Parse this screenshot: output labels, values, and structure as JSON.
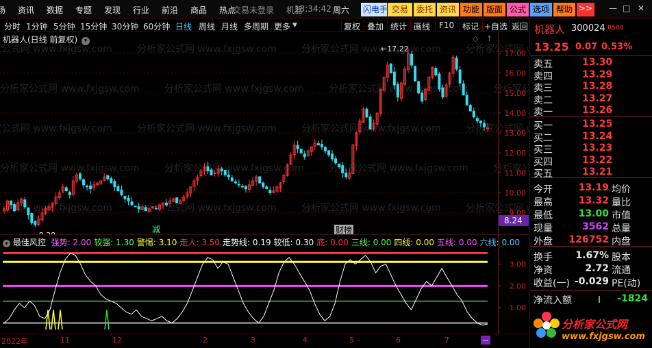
{
  "menubar": {
    "items": [
      "场",
      "资讯",
      "数据",
      "专题",
      "发现",
      "行业",
      "前沿",
      "商品",
      "热点"
    ],
    "login_status": "交易未登录",
    "robot_label": "机器",
    "clock": "13:34:42",
    "weekday": "周六",
    "tools": [
      {
        "label": "闪电手",
        "bg": "#cfe4ff",
        "fg": "#0033aa"
      },
      {
        "label": "交易",
        "bg": "#ffd94a",
        "fg": "#7a3000"
      },
      {
        "label": "委托",
        "bg": "#ffd94a",
        "fg": "#7a3000"
      },
      {
        "label": "资讯",
        "bg": "#ffd94a",
        "fg": "#7a3000"
      },
      {
        "label": "功能",
        "bg": "#ff7a1a",
        "fg": "#000000"
      },
      {
        "label": "版面",
        "bg": "#ff7a1a",
        "fg": "#000000"
      },
      {
        "label": "公式",
        "bg": "#ff5aaa",
        "fg": "#000000"
      },
      {
        "label": "选项",
        "bg": "#5aa0ff",
        "fg": "#000000"
      },
      {
        "label": "帮助",
        "bg": "#ff7a1a",
        "fg": "#000000"
      },
      {
        "label": ">>",
        "bg": "#ff3030",
        "fg": "#ffffff"
      }
    ]
  },
  "periods": {
    "items": [
      "分时",
      "1分钟",
      "5分钟",
      "15分钟",
      "30分钟",
      "60分钟",
      "日线",
      "周线",
      "月线",
      "多周期",
      "更多"
    ],
    "active": "日线",
    "right_tools": [
      "复权",
      "叠加",
      "统计",
      "画线",
      "F10",
      "标记",
      "+自选",
      "返回"
    ]
  },
  "chart": {
    "title": "机器人(日线 前复权)",
    "y_ticks": [
      "17.00",
      "16.00",
      "15.00",
      "14.00",
      "13.00",
      "12.00",
      "11.00",
      "10.00",
      "9.00"
    ],
    "high_label": "17.22",
    "low_label": "8.38",
    "current_price_tag": "8.24",
    "event_labels": [
      "减",
      "财榜"
    ],
    "watermark": "分析家公式网 www.fxjgsw.com",
    "colors": {
      "up": "#ff3333",
      "down": "#33ddee",
      "grid": "#5a0000",
      "bg": "#000000"
    },
    "chart_data": {
      "type": "candlestick",
      "title": "机器人(日线 前复权)",
      "ylim": [
        8.2,
        17.6
      ],
      "max_label": 17.22,
      "min_label": 8.38,
      "closes": [
        9.2,
        9.6,
        9.4,
        9.1,
        9.5,
        9.7,
        9.3,
        8.9,
        8.5,
        8.4,
        8.7,
        9.0,
        9.2,
        9.3,
        9.5,
        9.8,
        10.0,
        10.3,
        10.1,
        9.9,
        10.6,
        10.9,
        10.7,
        10.4,
        10.3,
        10.2,
        10.4,
        10.5,
        10.6,
        10.8,
        10.7,
        10.5,
        10.3,
        10.1,
        9.9,
        9.7,
        9.6,
        9.4,
        9.3,
        9.2,
        9.3,
        9.1,
        9.2,
        9.3,
        9.2,
        9.4,
        9.5,
        9.4,
        9.6,
        9.7,
        9.5,
        9.6,
        9.8,
        10.0,
        10.3,
        10.6,
        10.8,
        11.1,
        11.3,
        11.1,
        10.9,
        11.0,
        11.2,
        11.1,
        10.9,
        10.8,
        10.6,
        10.5,
        10.4,
        10.3,
        10.2,
        10.4,
        10.6,
        10.8,
        10.5,
        10.3,
        10.2,
        10.0,
        10.1,
        10.3,
        10.5,
        10.9,
        11.4,
        11.9,
        12.4,
        12.2,
        12.0,
        11.8,
        12.1,
        12.3,
        12.5,
        12.4,
        12.3,
        12.1,
        11.9,
        11.7,
        11.5,
        11.3,
        11.0,
        10.8,
        11.0,
        12.4,
        13.0,
        13.6,
        14.2,
        13.8,
        13.2,
        13.5,
        14.0,
        15.2,
        15.8,
        16.4,
        16.0,
        15.4,
        14.8,
        15.5,
        16.2,
        17.0,
        16.4,
        15.6,
        15.0,
        14.6,
        15.2,
        15.8,
        16.3,
        15.9,
        15.2,
        14.8,
        15.4,
        16.0,
        16.8,
        16.2,
        15.5,
        14.9,
        14.4,
        14.1,
        13.8,
        13.6,
        13.5,
        13.3,
        13.25
      ]
    }
  },
  "indicator": {
    "name": "最佳风控",
    "legend": [
      {
        "label": "强势:",
        "value": "2.00",
        "color": "#ff55ff"
      },
      {
        "label": "较强:",
        "value": "1.30",
        "color": "#55ff55"
      },
      {
        "label": "警惕:",
        "value": "3.10",
        "color": "#ffff33"
      },
      {
        "label": "走人:",
        "value": "3.50",
        "color": "#ff3333"
      },
      {
        "label": "走势线:",
        "value": "0.19",
        "color": "#ffffff"
      },
      {
        "label": "较低:",
        "value": "0.30",
        "color": "#ffffff"
      },
      {
        "label": "底:",
        "value": "0.00",
        "color": "#ff3333"
      },
      {
        "label": "三线:",
        "value": "0.00",
        "color": "#55ff55"
      },
      {
        "label": "四线:",
        "value": "0.00",
        "color": "#ffff33"
      },
      {
        "label": "五线:",
        "value": "0.00",
        "color": "#ff55ff"
      },
      {
        "label": "六线:",
        "value": "0.00",
        "color": "#55ccff"
      }
    ],
    "y_ticks": [
      "3.00",
      "2.00",
      "1.00"
    ],
    "levels": [
      {
        "value": 3.5,
        "color": "#ff3333"
      },
      {
        "value": 3.1,
        "color": "#ffff33"
      },
      {
        "value": 2.0,
        "color": "#ff44ff"
      },
      {
        "value": 1.3,
        "color": "#33dd33"
      },
      {
        "value": 0.3,
        "color": "#ffffff"
      }
    ],
    "chart_data": {
      "type": "line",
      "ylim": [
        0,
        3.8
      ],
      "trend": [
        0.3,
        0.5,
        0.9,
        1.2,
        1.0,
        1.3,
        1.1,
        0.6,
        0.5,
        0.9,
        1.8,
        2.6,
        3.2,
        3.5,
        3.4,
        3.0,
        2.5,
        2.2,
        2.0,
        1.6,
        1.4,
        1.3,
        1.2,
        1.0,
        0.8,
        0.7,
        0.9,
        0.6,
        0.5,
        0.4,
        0.5,
        0.6,
        0.4,
        0.3,
        0.5,
        0.8,
        1.2,
        1.8,
        2.4,
        3.0,
        3.3,
        3.2,
        2.8,
        3.1,
        3.0,
        2.4,
        1.8,
        1.2,
        0.8,
        0.5,
        0.3,
        0.6,
        1.2,
        1.8,
        2.6,
        3.1,
        3.3,
        3.0,
        2.6,
        2.2,
        1.8,
        1.2,
        0.7,
        0.4,
        0.6,
        1.2,
        2.2,
        3.0,
        3.2,
        3.0,
        3.2,
        3.4,
        3.1,
        2.6,
        2.9,
        3.0,
        2.5,
        2.0,
        1.6,
        1.2,
        0.9,
        1.4,
        1.9,
        2.2,
        2.0,
        2.4,
        2.8,
        2.4,
        2.0,
        1.6,
        1.3,
        0.8,
        0.5,
        0.3,
        0.2,
        0.25
      ]
    }
  },
  "xaxis": {
    "labels": [
      "2022年",
      "11",
      "12",
      "2",
      "3",
      "4",
      "5",
      "6",
      "7"
    ],
    "end_marker": "--"
  },
  "right_panel": {
    "stock_name": "机器人",
    "stock_code": "300024",
    "badge": "R500",
    "price": "13.25",
    "change": "0.07",
    "change_pct": "0.53%",
    "asks": [
      {
        "label": "卖五",
        "price": "13.30"
      },
      {
        "label": "卖四",
        "price": "13.29"
      },
      {
        "label": "卖三",
        "price": "13.28"
      },
      {
        "label": "卖二",
        "price": "13.27"
      },
      {
        "label": "卖一",
        "price": "13.26"
      }
    ],
    "bids": [
      {
        "label": "买一",
        "price": "13.25"
      },
      {
        "label": "买二",
        "price": "13.24"
      },
      {
        "label": "买三",
        "price": "13.23"
      },
      {
        "label": "买四",
        "price": "13.22"
      },
      {
        "label": "买五",
        "price": "13.21"
      }
    ],
    "stats1": [
      {
        "label": "今开",
        "value": "13.19",
        "color": "#ff3a3a",
        "label2": "均价"
      },
      {
        "label": "最高",
        "value": "13.32",
        "color": "#ff3a3a",
        "label2": "量比"
      },
      {
        "label": "最低",
        "value": "13.00",
        "color": "#33dd33",
        "label2": "市值"
      },
      {
        "label": "现量",
        "value": "3562",
        "color": "#cc44ff",
        "label2": "总量"
      },
      {
        "label": "外盘",
        "value": "126752",
        "color": "#ff3a3a",
        "label2": "内盘"
      }
    ],
    "stats2": [
      {
        "label": "换手",
        "value": "1.67%",
        "color": "#e8e8e8",
        "label2": "股本"
      },
      {
        "label": "净资",
        "value": "2.72",
        "color": "#e8e8e8",
        "label2": "流通"
      },
      {
        "label": "收益(一)",
        "value": "-0.029",
        "color": "#e8e8e8",
        "label2": "PE(动)"
      }
    ],
    "net_inflow_label": "净流入额",
    "net_inflow_value": "-1824",
    "logo_text": "分析家公式网",
    "logo_url": "www.fxjgsw.com"
  }
}
